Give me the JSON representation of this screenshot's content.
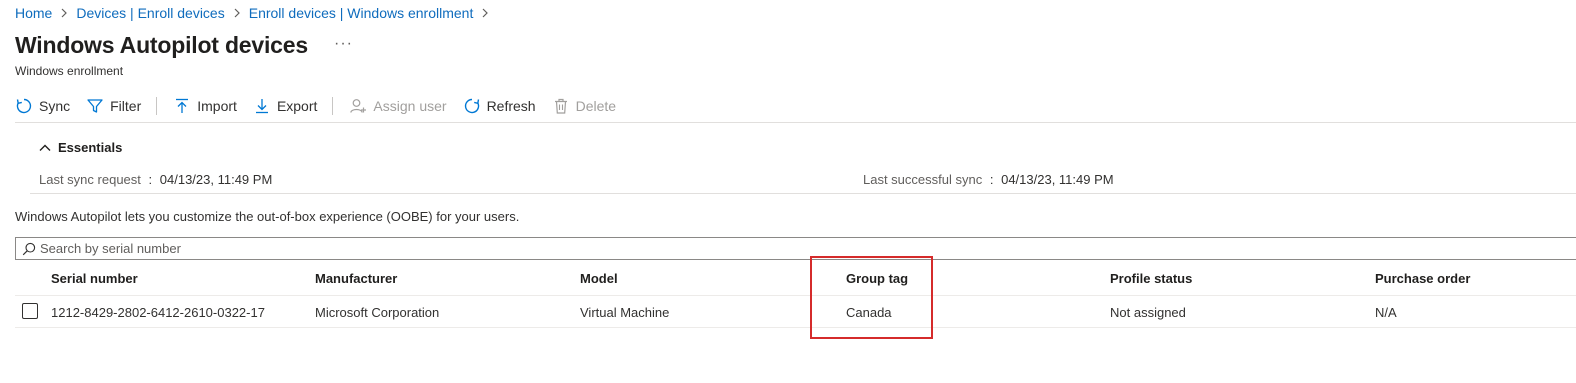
{
  "breadcrumb": {
    "items": [
      "Home",
      "Devices | Enroll devices",
      "Enroll devices | Windows enrollment"
    ]
  },
  "page": {
    "title": "Windows Autopilot devices",
    "more": "···",
    "subtitle": "Windows enrollment"
  },
  "toolbar": {
    "sync": "Sync",
    "filter": "Filter",
    "import": "Import",
    "export": "Export",
    "assign_user": "Assign user",
    "refresh": "Refresh",
    "delete": "Delete"
  },
  "essentials": {
    "label": "Essentials",
    "last_sync_request_key": "Last sync request",
    "last_sync_request_value": "04/13/23, 11:49 PM",
    "last_successful_sync_key": "Last successful sync",
    "last_successful_sync_value": "04/13/23, 11:49 PM",
    "separator": ":"
  },
  "description": "Windows Autopilot lets you customize the out-of-box experience (OOBE) for your users.",
  "search": {
    "placeholder": "Search by serial number",
    "value": ""
  },
  "table": {
    "columns": [
      "Serial number",
      "Manufacturer",
      "Model",
      "Group tag",
      "Profile status",
      "Purchase order"
    ],
    "rows": [
      {
        "serial": "1212-8429-2802-6412-2610-0322-17",
        "manufacturer": "Microsoft Corporation",
        "model": "Virtual Machine",
        "group_tag": "Canada",
        "profile_status": "Not assigned",
        "purchase_order": "N/A"
      }
    ]
  },
  "colors": {
    "link": "#0f6cbd",
    "accent": "#0078d4",
    "highlight_border": "#d52b2b",
    "disabled": "#a19f9d"
  },
  "icons": [
    "chevron-right-icon",
    "more-icon",
    "sync-icon",
    "filter-icon",
    "import-icon",
    "export-icon",
    "assign-user-icon",
    "refresh-icon",
    "delete-icon",
    "chevron-up-icon",
    "search-icon",
    "checkbox"
  ]
}
